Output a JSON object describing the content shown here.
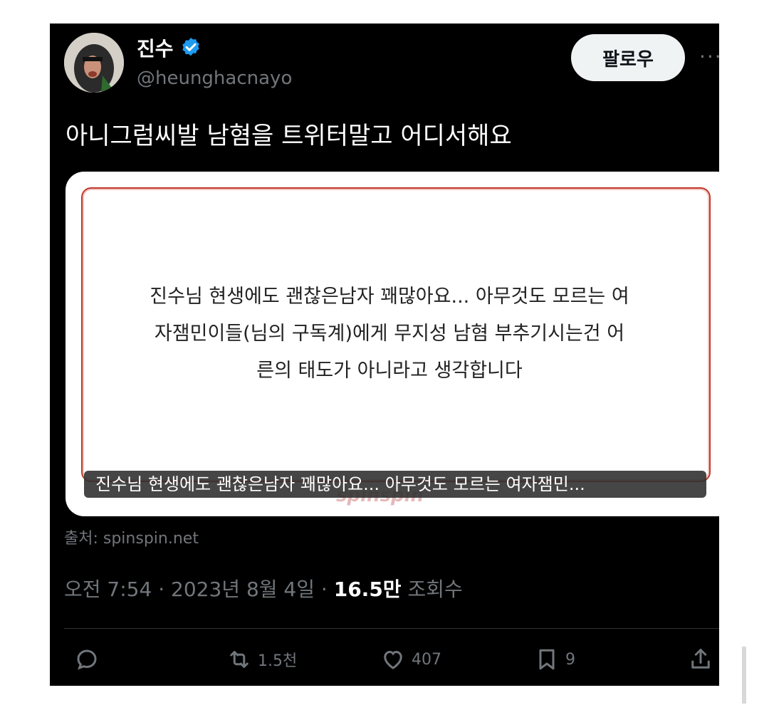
{
  "author": {
    "name": "진수",
    "handle": "@heunghacnayo"
  },
  "follow_label": "팔로우",
  "more_label": "···",
  "tweet_text": "아니그럼씨발 남혐을 트위터말고 어디서해요",
  "card": {
    "body_lines": [
      "진수님 현생에도 괜찮은남자 꽤많아요... 아무것도 모르는 여",
      "자잼민이들(님의 구독계)에게 무지성 남혐 부추기시는건 어",
      "른의 태도가 아니라고 생각합니다"
    ],
    "watermark": "spinspin",
    "caption": "진수님 현생에도 괜찮은남자 꽤많아요... 아무것도 모르는 여자잼민..."
  },
  "source": "출처: spinspin.net",
  "meta": {
    "time": "오전 7:54",
    "date": "2023년 8월 4일",
    "views_count": "16.5만",
    "views_label": "조회수"
  },
  "actions": {
    "reply": "",
    "retweet": "1.5천",
    "like": "407",
    "bookmark": "9"
  },
  "colors": {
    "background": "#000000",
    "muted": "#71767b",
    "verified": "#1d9bf0"
  }
}
